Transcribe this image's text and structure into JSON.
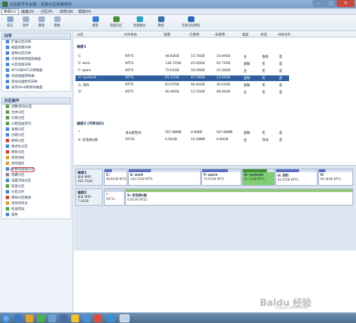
{
  "window": {
    "title": "分区助手专业版 - 无损分区免费软件"
  },
  "menu": [
    "常规(G)",
    "磁盘(D)",
    "分区(P)",
    "向导(W)",
    "帮助(H)"
  ],
  "toolbar": [
    {
      "label": "提交",
      "icon": "check-icon"
    },
    {
      "label": "放弃",
      "icon": "discard-icon"
    },
    {
      "label": "撤销",
      "icon": "undo-icon"
    },
    {
      "label": "重做",
      "icon": "redo-icon"
    },
    {
      "label": "刷新",
      "icon": "refresh-icon"
    },
    {
      "label": "快速分区",
      "icon": "quick-partition-icon"
    },
    {
      "label": "免费备份",
      "icon": "backup-icon"
    },
    {
      "label": "教程",
      "icon": "tutorial-icon"
    },
    {
      "label": "无损分区教程",
      "icon": "help-icon"
    }
  ],
  "sidebar": {
    "wizard_title": "向导",
    "wizard_items": [
      "扩展分区向导",
      "磁盘克隆向导",
      "复制分区向导",
      "迁移系统到固态磁盘",
      "分区恢复向导",
      "NTFS到FAT32转换器",
      "动态磁盘转换器",
      "启动光盘制作向导",
      "安装Win8到移动磁盘"
    ],
    "ops_title": "分区操作",
    "ops_items": [
      "调整/移动分区",
      "合并分区",
      "切割分区",
      "分配自由空间",
      "复制分区",
      "创建分区",
      "删除分区",
      "格式化分区",
      "擦除分区",
      "更改卷标",
      "更改盘符",
      "转换到逻辑分区",
      "隐藏分区",
      "设置活动分区",
      "检查分区",
      "分区对齐",
      "擦除分区数据",
      "更改序列号",
      "检查错误",
      "属性"
    ]
  },
  "table": {
    "columns": [
      "分区",
      "文件系统",
      "容量",
      "已使用",
      "未使用",
      "类型",
      "状态",
      "4KB对齐"
    ],
    "disk1_title": "磁盘1",
    "disk1_rows": [
      [
        "C:",
        "NTFS",
        "48.83GB",
        "15.74GB",
        "33.09GB",
        "主",
        "系统",
        "是"
      ],
      [
        "E: work",
        "NTFS",
        "136.72GB",
        "43.00GB",
        "93.72GB",
        "逻辑",
        "无",
        "是"
      ],
      [
        "F: spare",
        "NTFS",
        "75.61GB",
        "50.59GB",
        "25.50GB",
        "主",
        "无",
        "是"
      ],
      [
        "H: system2",
        "NTFS",
        "61.11GB",
        "47.18GB",
        "13.93GB",
        "逻辑",
        "无",
        "是"
      ],
      [
        "G: 资料",
        "NTFS",
        "83.07GB",
        "46.44GB",
        "36.63GB",
        "逻辑",
        "无",
        "是"
      ],
      [
        "D:",
        "NTFS",
        "60.46GB",
        "11.52GB",
        "48.94GB",
        "主",
        "无",
        "是"
      ]
    ],
    "disk2_title": "磁盘2 (可移动的)",
    "disk2_rows": [
      [
        "*",
        "未分配空间",
        "507.88MB",
        "0.00KB",
        "507.88MB",
        "逻辑",
        "无",
        "是"
      ],
      [
        "K: 老毛桃U盘",
        "FAT32",
        "6.91GB",
        "14.18MB",
        "6.90GB",
        "主",
        "活动",
        "是"
      ]
    ]
  },
  "diskmap": {
    "disk1": {
      "name": "磁盘1",
      "type": "基本 MBR",
      "size": "465.76GB"
    },
    "disk1_parts": [
      {
        "label": "C:",
        "info": "48.83GB NTFS",
        "used": 0.32
      },
      {
        "label": "E: work",
        "info": "136.72GB NTFS",
        "used": 0.31
      },
      {
        "label": "F: spare",
        "info": "75.61GB NTFS",
        "used": 0.67
      },
      {
        "label": "H: system2",
        "info": "61.11GB NTFS",
        "used": 0.77
      },
      {
        "label": "G: 资料",
        "info": "83.07GB NTFS",
        "used": 0.56
      },
      {
        "label": "D:",
        "info": "60.46GB NTFS",
        "used": 0.19
      }
    ],
    "disk2": {
      "name": "磁盘2",
      "type": "基本 MBR",
      "size": "7.40GB"
    },
    "disk2_parts": [
      {
        "label": "*",
        "info": "507.8..."
      },
      {
        "label": "K: 老毛桃U盘",
        "info": "6.91GB FAT32"
      }
    ]
  },
  "watermark": {
    "main": "Baidu 经验",
    "sub": "jingyan.baidu.com"
  },
  "colors": {
    "selected_row": "#2f5f9e",
    "selected_partition": "#7fcf70",
    "used_bar": "#5b6fc1",
    "circle_highlight": "#d23b3b"
  }
}
